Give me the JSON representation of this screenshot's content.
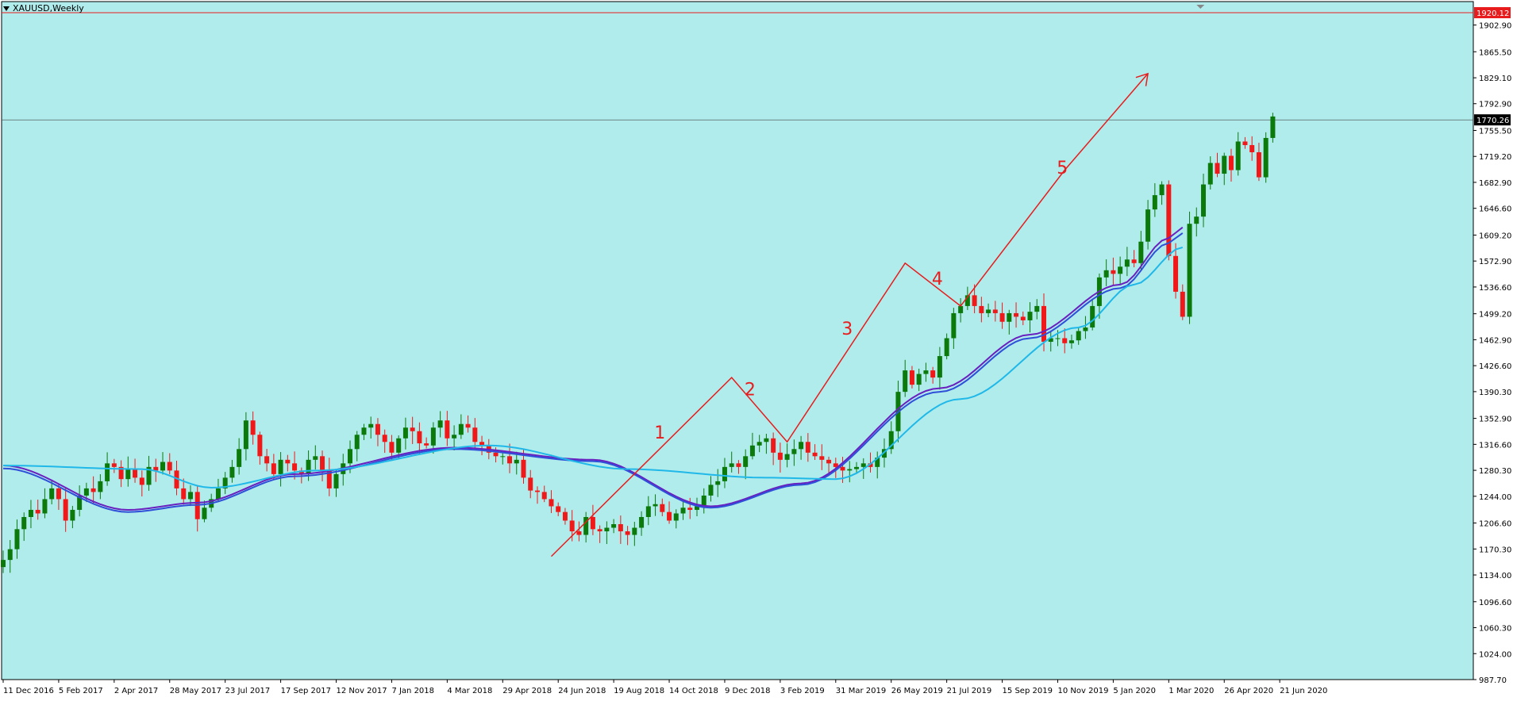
{
  "window": {
    "symbol_title": "XAUUSD,Weekly"
  },
  "colors": {
    "background": "#b0ecec",
    "axis_background": "#ffffff",
    "bull_candle": "#0b7a0b",
    "bear_candle": "#f01818",
    "ma_fast": "#6a1fbf",
    "ma_mid": "#2f4fd8",
    "ma_slow": "#20b8e8",
    "wave_line": "#e81c1c",
    "price_line": "#444444",
    "level_line": "#e81c1c"
  },
  "chart_data": {
    "type": "candlestick",
    "symbol": "XAUUSD",
    "timeframe": "Weekly",
    "ylim": [
      987.7,
      1920.12
    ],
    "y_ticks": [
      "1902.90",
      "1865.50",
      "1829.10",
      "1792.90",
      "1755.50",
      "1719.20",
      "1682.90",
      "1646.60",
      "1609.20",
      "1572.90",
      "1536.60",
      "1499.20",
      "1462.90",
      "1426.60",
      "1390.30",
      "1352.90",
      "1316.60",
      "1280.30",
      "1244.00",
      "1206.60",
      "1170.30",
      "1134.00",
      "1096.60",
      "1060.30",
      "1024.00",
      "987.70"
    ],
    "x_ticks": [
      "11 Dec 2016",
      "5 Feb 2017",
      "2 Apr 2017",
      "28 May 2017",
      "23 Jul 2017",
      "17 Sep 2017",
      "12 Nov 2017",
      "7 Jan 2018",
      "4 Mar 2018",
      "29 Apr 2018",
      "24 Jun 2018",
      "19 Aug 2018",
      "14 Oct 2018",
      "9 Dec 2018",
      "3 Feb 2019",
      "31 Mar 2019",
      "26 May 2019",
      "21 Jul 2019",
      "15 Sep 2019",
      "10 Nov 2019",
      "5 Jan 2020",
      "1 Mar 2020",
      "26 Apr 2020",
      "21 Jun 2020"
    ],
    "current_price": "1770.26",
    "level_label": "1920.12",
    "closes": [
      1155,
      1170,
      1198,
      1215,
      1225,
      1220,
      1240,
      1255,
      1240,
      1210,
      1225,
      1245,
      1255,
      1250,
      1265,
      1290,
      1285,
      1268,
      1282,
      1270,
      1260,
      1285,
      1280,
      1292,
      1280,
      1255,
      1240,
      1250,
      1212,
      1228,
      1240,
      1255,
      1270,
      1285,
      1310,
      1350,
      1330,
      1300,
      1290,
      1275,
      1295,
      1290,
      1280,
      1275,
      1295,
      1300,
      1280,
      1255,
      1275,
      1290,
      1310,
      1330,
      1340,
      1345,
      1330,
      1320,
      1305,
      1325,
      1340,
      1335,
      1318,
      1315,
      1340,
      1350,
      1325,
      1330,
      1345,
      1340,
      1320,
      1315,
      1305,
      1300,
      1300,
      1290,
      1295,
      1270,
      1252,
      1250,
      1240,
      1230,
      1222,
      1210,
      1195,
      1190,
      1215,
      1198,
      1195,
      1200,
      1205,
      1195,
      1190,
      1200,
      1215,
      1230,
      1233,
      1222,
      1210,
      1220,
      1228,
      1225,
      1230,
      1245,
      1260,
      1265,
      1285,
      1290,
      1285,
      1300,
      1315,
      1320,
      1325,
      1305,
      1295,
      1303,
      1310,
      1320,
      1305,
      1300,
      1295,
      1290,
      1285,
      1280,
      1282,
      1285,
      1290,
      1285,
      1298,
      1310,
      1335,
      1390,
      1420,
      1400,
      1415,
      1420,
      1410,
      1440,
      1465,
      1500,
      1510,
      1525,
      1510,
      1500,
      1505,
      1500,
      1488,
      1500,
      1495,
      1490,
      1502,
      1510,
      1460,
      1465,
      1465,
      1458,
      1462,
      1475,
      1480,
      1510,
      1550,
      1560,
      1555,
      1565,
      1575,
      1570,
      1600,
      1645,
      1665,
      1680,
      1580,
      1530,
      1495,
      1625,
      1635,
      1680,
      1710,
      1695,
      1720,
      1700,
      1740,
      1735,
      1725,
      1690,
      1745,
      1775
    ],
    "annotations": {
      "wave_labels": [
        "1",
        "2",
        "3",
        "4",
        "5"
      ],
      "wave_points": [
        {
          "week": 79,
          "price": 1160
        },
        {
          "week": 105,
          "price": 1410
        },
        {
          "week": 113,
          "price": 1320
        },
        {
          "week": 130,
          "price": 1570
        },
        {
          "week": 138,
          "price": 1510
        },
        {
          "week": 153,
          "price": 1700
        },
        {
          "week": 165,
          "price": 1835
        }
      ],
      "ma_series": [
        {
          "name": "",
          "color_key": "ma_fast",
          "anchors": [
            [
              0,
              1287
            ],
            [
              18,
              1225
            ],
            [
              28,
              1235
            ],
            [
              42,
              1275
            ],
            [
              65,
              1312
            ],
            [
              85,
              1295
            ],
            [
              102,
              1230
            ],
            [
              115,
              1262
            ],
            [
              135,
              1395
            ],
            [
              148,
              1470
            ],
            [
              161,
              1540
            ],
            [
              168,
              1605
            ],
            [
              170,
              1620
            ]
          ]
        },
        {
          "name": "",
          "color_key": "ma_mid",
          "anchors": [
            [
              0,
              1283
            ],
            [
              18,
              1222
            ],
            [
              28,
              1232
            ],
            [
              42,
              1272
            ],
            [
              65,
              1310
            ],
            [
              85,
              1293
            ],
            [
              102,
              1228
            ],
            [
              115,
              1260
            ],
            [
              135,
              1390
            ],
            [
              148,
              1465
            ],
            [
              161,
              1535
            ],
            [
              168,
              1598
            ],
            [
              170,
              1612
            ]
          ]
        },
        {
          "name": "",
          "color_key": "ma_slow",
          "anchors": [
            [
              0,
              1287
            ],
            [
              20,
              1282
            ],
            [
              30,
              1256
            ],
            [
              45,
              1280
            ],
            [
              70,
              1315
            ],
            [
              90,
              1282
            ],
            [
              110,
              1270
            ],
            [
              120,
              1268
            ],
            [
              138,
              1380
            ],
            [
              155,
              1480
            ],
            [
              163,
              1540
            ],
            [
              170,
              1592
            ]
          ]
        }
      ]
    }
  }
}
